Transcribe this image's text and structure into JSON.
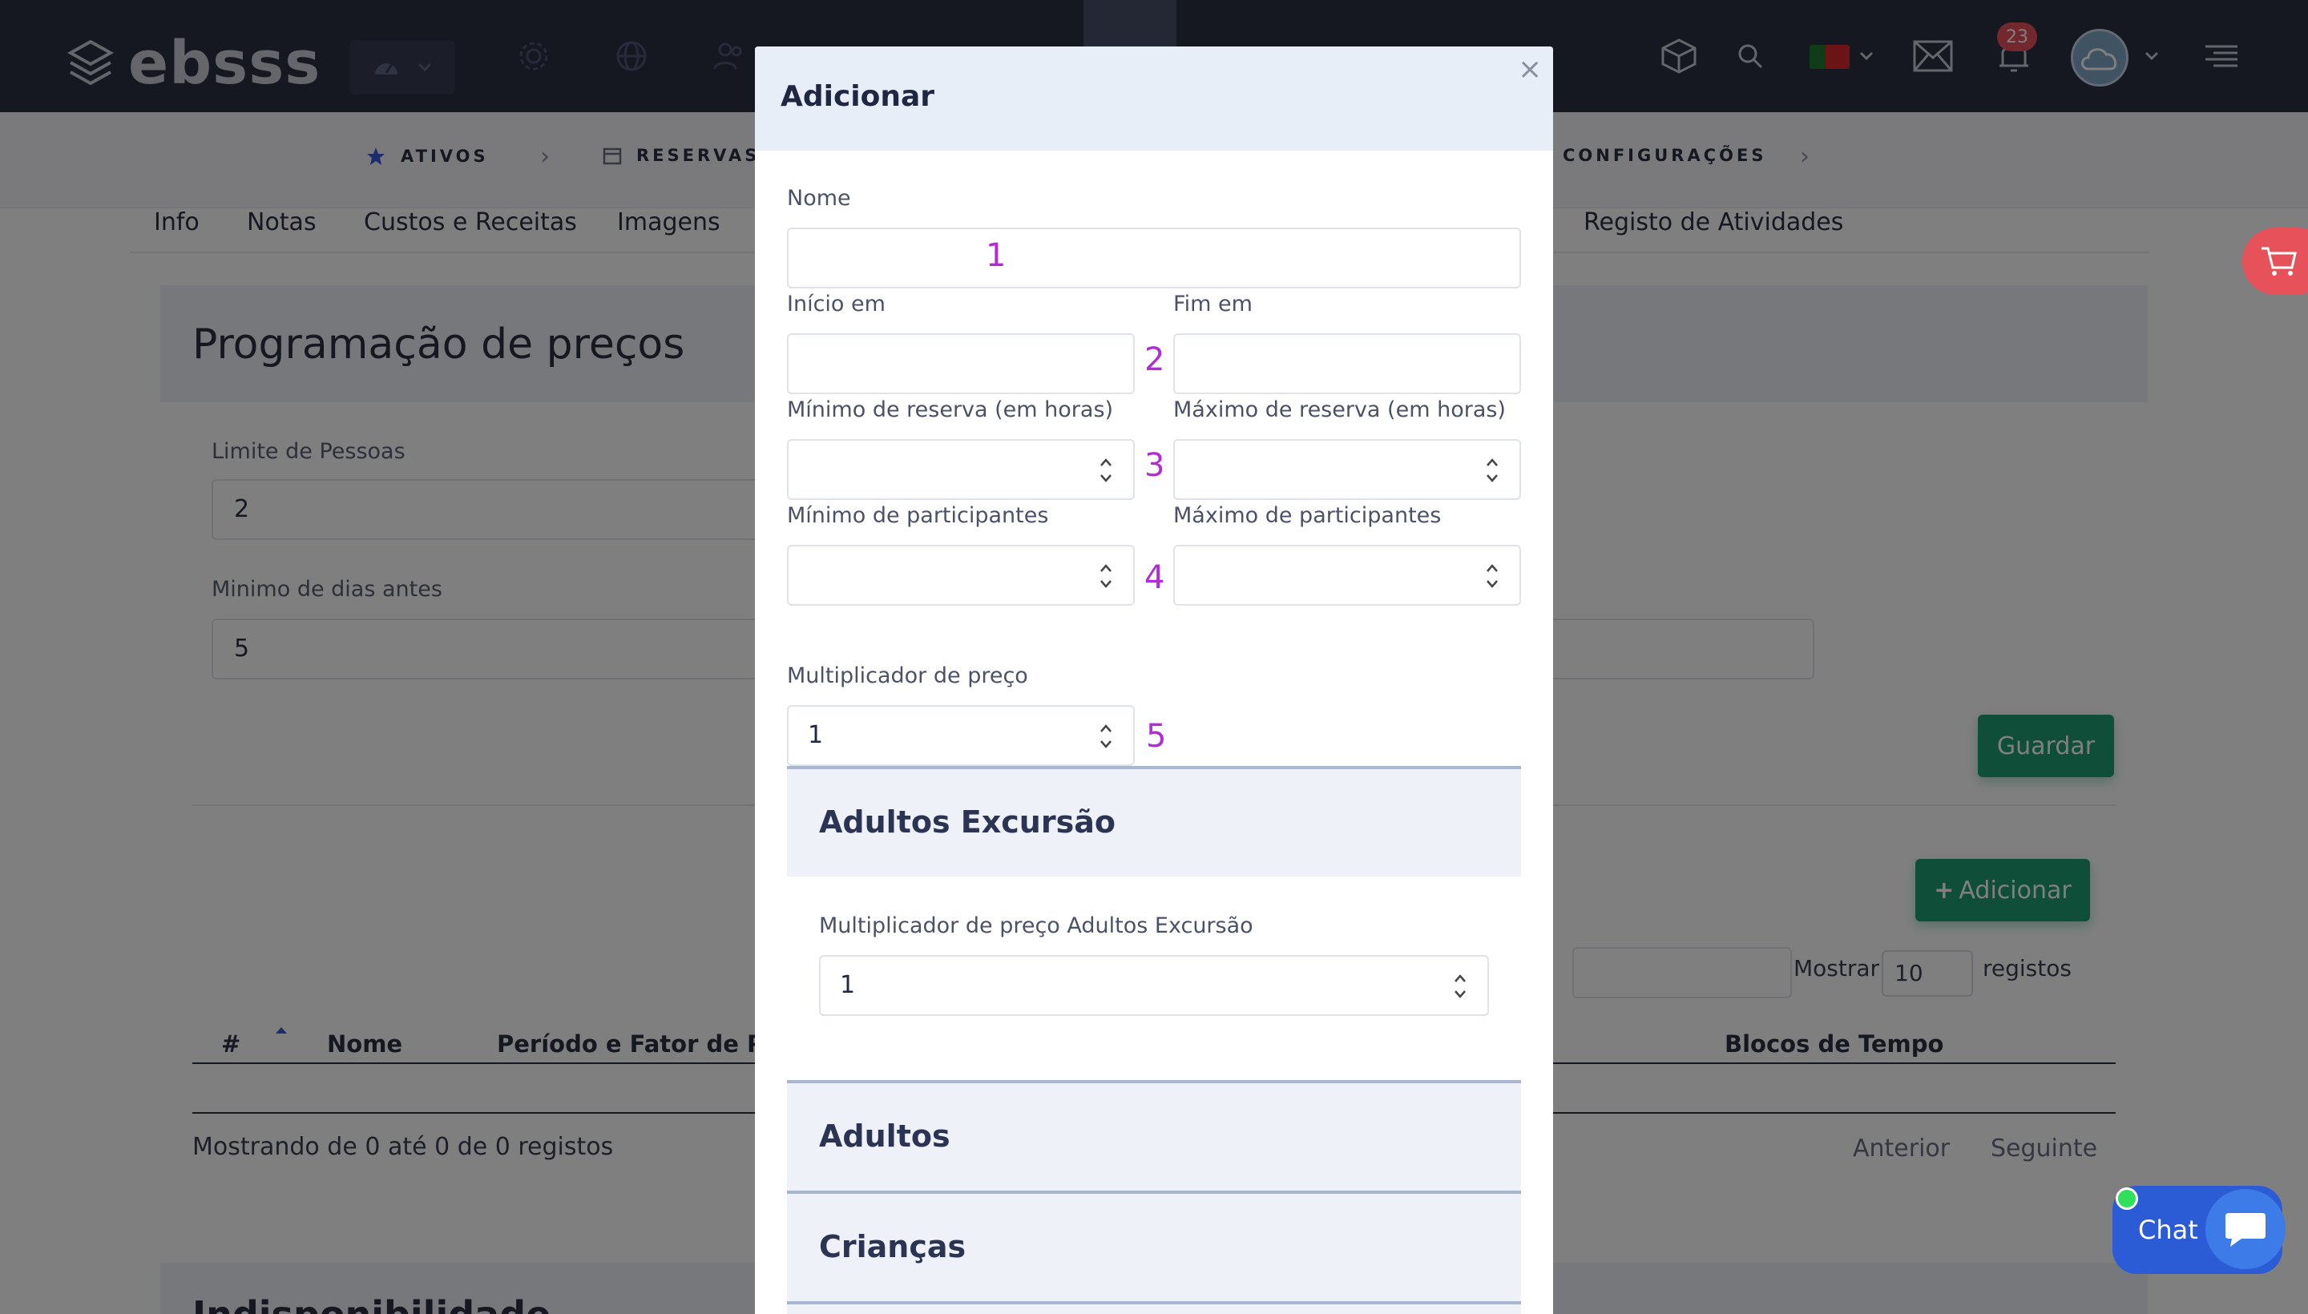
{
  "app": {
    "brand": "ebsss"
  },
  "topbar": {
    "notifications_count": "23",
    "colors": {
      "bg": "#2b3041",
      "badge": "#e7515a"
    }
  },
  "breadcrumb": {
    "items": [
      "ATIVOS",
      "RESERVAS",
      "CONFIGURAÇÕES"
    ]
  },
  "tabs": [
    "Info",
    "Notas",
    "Custos e Receitas",
    "Imagens",
    "Registo de Atividades"
  ],
  "page": {
    "section_title": "Programação de preços",
    "limite_label": "Limite de Pessoas",
    "limite_value": "2",
    "minimo_dias_label": "Minimo de dias antes",
    "minimo_dias_value": "5",
    "save_label": "Guardar",
    "add_label": "Adicionar",
    "show_label": "Mostrar",
    "show_value": "10",
    "records_label": "registos",
    "table_headers": [
      "#",
      "Nome",
      "Período e Fator de Preç",
      "Blocos de Tempo"
    ],
    "footer_info": "Mostrando de 0 até 0 de 0 registos",
    "prev_label": "Anterior",
    "next_label": "Seguinte",
    "lower_section_title": "Indisponibilidade"
  },
  "modal": {
    "title": "Adicionar",
    "close_glyph": "×",
    "nome_label": "Nome",
    "nome_value": "",
    "inicio_label": "Início em",
    "fim_label": "Fim em",
    "min_reserva_label": "Mínimo de reserva (em horas)",
    "max_reserva_label": "Máximo de reserva (em horas)",
    "min_part_label": "Mínimo de participantes",
    "max_part_label": "Máximo de participantes",
    "mult_label": "Multiplicador de preço",
    "mult_value": "1",
    "markers": [
      "1",
      "2",
      "3",
      "4",
      "5"
    ],
    "accordion": [
      {
        "title": "Adultos Excursão",
        "field_label": "Multiplicador de preço Adultos Excursão",
        "field_value": "1"
      },
      {
        "title": "Adultos"
      },
      {
        "title": "Crianças"
      }
    ]
  },
  "chat": {
    "label": "Chat"
  }
}
